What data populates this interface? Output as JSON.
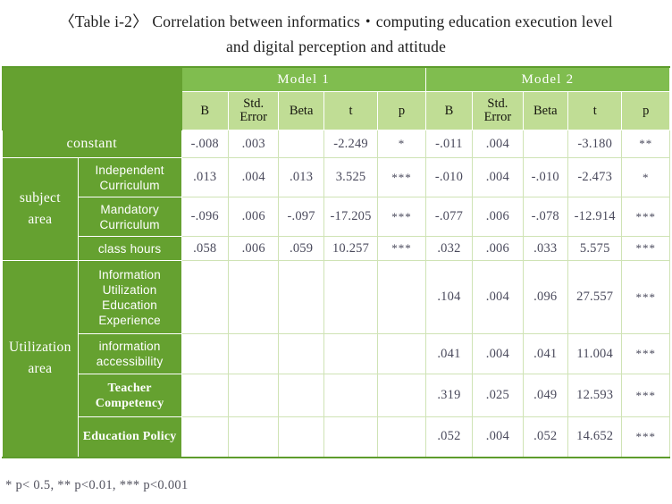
{
  "title": {
    "line1": "〈Table i-2〉 Correlation between informatics・computing education execution level",
    "line2": "and digital perception and attitude"
  },
  "table": {
    "model_headers": [
      "Model 1",
      "Model 2"
    ],
    "sub_headers": [
      "B",
      "Std. Error",
      "Beta",
      "t",
      "p"
    ],
    "sub_headers_split": [
      {
        "l1": "B",
        "l2": ""
      },
      {
        "l1": "Std.",
        "l2": "Error"
      },
      {
        "l1": "Beta",
        "l2": ""
      },
      {
        "l1": "t",
        "l2": ""
      },
      {
        "l1": "p",
        "l2": ""
      }
    ],
    "groups": [
      {
        "name": "subject area",
        "name_l1": "subject",
        "name_l2": "area"
      },
      {
        "name": "Utilization area",
        "name_l1": "Utilization",
        "name_l2": "area"
      }
    ],
    "constant_label": "constant",
    "rows": [
      {
        "label": "constant",
        "m1": {
          "B": "-.008",
          "se": ".003",
          "beta": "",
          "t": "-2.249",
          "p": "*"
        },
        "m2": {
          "B": "-.011",
          "se": ".004",
          "beta": "",
          "t": "-3.180",
          "p": "**"
        }
      },
      {
        "label": "Independent Curriculum",
        "label_l1": "Independent",
        "label_l2": "Curriculum",
        "m1": {
          "B": ".013",
          "se": ".004",
          "beta": ".013",
          "t": "3.525",
          "p": "***"
        },
        "m2": {
          "B": "-.010",
          "se": ".004",
          "beta": "-.010",
          "t": "-2.473",
          "p": "*"
        }
      },
      {
        "label": "Mandatory Curriculum",
        "label_l1": "Mandatory",
        "label_l2": "Curriculum",
        "m1": {
          "B": "-.096",
          "se": ".006",
          "beta": "-.097",
          "t": "-17.205",
          "p": "***"
        },
        "m2": {
          "B": "-.077",
          "se": ".006",
          "beta": "-.078",
          "t": "-12.914",
          "p": "***"
        }
      },
      {
        "label": "class hours",
        "label_l1": "class hours",
        "label_l2": "",
        "m1": {
          "B": ".058",
          "se": ".006",
          "beta": ".059",
          "t": "10.257",
          "p": "***"
        },
        "m2": {
          "B": ".032",
          "se": ".006",
          "beta": ".033",
          "t": "5.575",
          "p": "***"
        }
      },
      {
        "label": "Information Utilization Education Experience",
        "label_l1": "Information",
        "label_l2": "Utilization",
        "label_l3": "Education",
        "label_l4": "Experience",
        "m1": {
          "B": "",
          "se": "",
          "beta": "",
          "t": "",
          "p": ""
        },
        "m2": {
          "B": ".104",
          "se": ".004",
          "beta": ".096",
          "t": "27.557",
          "p": "***"
        }
      },
      {
        "label": "information accessibility",
        "label_l1": "information",
        "label_l2": "accessibility",
        "m1": {
          "B": "",
          "se": "",
          "beta": "",
          "t": "",
          "p": ""
        },
        "m2": {
          "B": ".041",
          "se": ".004",
          "beta": ".041",
          "t": "11.004",
          "p": "***"
        }
      },
      {
        "label": "Teacher Competency",
        "label_l1": "Teacher",
        "label_l2": "Competency",
        "m1": {
          "B": "",
          "se": "",
          "beta": "",
          "t": "",
          "p": ""
        },
        "m2": {
          "B": ".319",
          "se": ".025",
          "beta": ".049",
          "t": "12.593",
          "p": "***"
        }
      },
      {
        "label": "Education Policy",
        "label_l1": "Education  Policy",
        "label_l2": "",
        "m1": {
          "B": "",
          "se": "",
          "beta": "",
          "t": "",
          "p": ""
        },
        "m2": {
          "B": ".052",
          "se": ".004",
          "beta": ".052",
          "t": "14.652",
          "p": "***"
        }
      }
    ]
  },
  "footnote": "* p< 0.5, ** p<0.01, *** p<0.001",
  "colors": {
    "dark_green": "#65a130",
    "mid_green": "#80bd4f",
    "light_green": "#c0dd95",
    "grid": "#cfe3b5",
    "rule": "#5d9c2c"
  }
}
